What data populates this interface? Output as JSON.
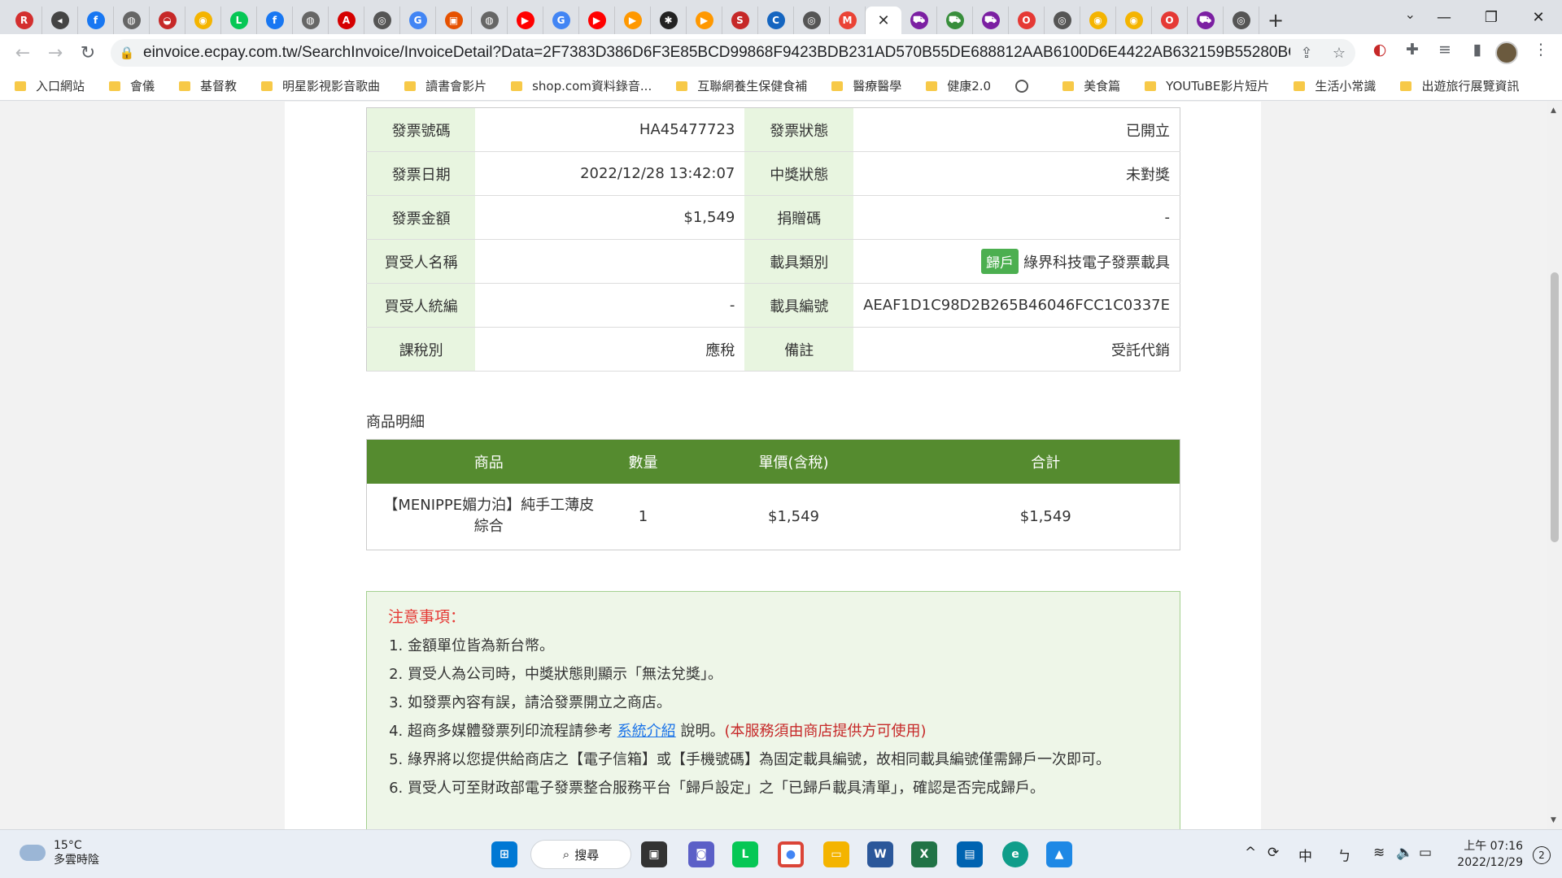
{
  "browser": {
    "tabs": [
      {
        "icon": "ruten-icon",
        "color": "#d32f2f",
        "glyph": "R"
      },
      {
        "icon": "mute-icon",
        "color": "#444",
        "glyph": "◂"
      },
      {
        "icon": "facebook-icon",
        "color": "#1877f2",
        "glyph": "f"
      },
      {
        "icon": "globe-icon",
        "color": "#666",
        "glyph": "◍"
      },
      {
        "icon": "shop-icon",
        "color": "#c62828",
        "glyph": "◒"
      },
      {
        "icon": "duck-icon",
        "color": "#f4b400",
        "glyph": "◉"
      },
      {
        "icon": "line-icon",
        "color": "#06c755",
        "glyph": "L"
      },
      {
        "icon": "facebook-icon",
        "color": "#1877f2",
        "glyph": "f"
      },
      {
        "icon": "globe-icon",
        "color": "#666",
        "glyph": "◍"
      },
      {
        "icon": "ad-icon",
        "color": "#d50000",
        "glyph": "A"
      },
      {
        "icon": "chrome-icon",
        "color": "#555",
        "glyph": "◎"
      },
      {
        "icon": "google-icon",
        "color": "#4285f4",
        "glyph": "G"
      },
      {
        "icon": "slides-icon",
        "color": "#e65100",
        "glyph": "▣"
      },
      {
        "icon": "globe-icon",
        "color": "#666",
        "glyph": "◍"
      },
      {
        "icon": "youtube-icon",
        "color": "#ff0000",
        "glyph": "▶"
      },
      {
        "icon": "google-icon",
        "color": "#4285f4",
        "glyph": "G"
      },
      {
        "icon": "youtube-icon",
        "color": "#ff0000",
        "glyph": "▶"
      },
      {
        "icon": "play-icon",
        "color": "#ff9800",
        "glyph": "▶"
      },
      {
        "icon": "maple-icon",
        "color": "#222",
        "glyph": "✱"
      },
      {
        "icon": "play-icon",
        "color": "#ff9800",
        "glyph": "▶"
      },
      {
        "icon": "skm-icon",
        "color": "#c62828",
        "glyph": "S"
      },
      {
        "icon": "cts-icon",
        "color": "#1565c0",
        "glyph": "C"
      },
      {
        "icon": "chrome-icon",
        "color": "#555",
        "glyph": "◎"
      },
      {
        "icon": "gmail-icon",
        "color": "#ea4335",
        "glyph": "M"
      },
      {
        "icon": "close-icon",
        "color": "#333",
        "glyph": "✕",
        "active": true
      },
      {
        "icon": "cart-icon",
        "color": "#7b1fa2",
        "glyph": "⛟"
      },
      {
        "icon": "cart-icon",
        "color": "#388e3c",
        "glyph": "⛟"
      },
      {
        "icon": "cart-icon",
        "color": "#7b1fa2",
        "glyph": "⛟"
      },
      {
        "icon": "opera-icon",
        "color": "#e53935",
        "glyph": "O"
      },
      {
        "icon": "chrome-icon",
        "color": "#555",
        "glyph": "◎"
      },
      {
        "icon": "duck-icon",
        "color": "#f4b400",
        "glyph": "◉"
      },
      {
        "icon": "duck-icon",
        "color": "#f4b400",
        "glyph": "◉"
      },
      {
        "icon": "opera-icon",
        "color": "#e53935",
        "glyph": "O"
      },
      {
        "icon": "cart-icon",
        "color": "#7b1fa2",
        "glyph": "⛟"
      },
      {
        "icon": "chrome-icon",
        "color": "#555",
        "glyph": "◎"
      }
    ],
    "new_tab": "+",
    "url": "einvoice.ecpay.com.tw/SearchInvoice/InvoiceDetail?Data=2F7383D386D6F3E85BCD99868F9423BDB231AD570B55DE688812AAB6100D6E4422AB632159B55280BCC3A0...",
    "bookmarks": [
      {
        "label": "入口網站",
        "type": "folder"
      },
      {
        "label": "會儀",
        "type": "folder"
      },
      {
        "label": "基督教",
        "type": "folder"
      },
      {
        "label": "明星影視影音歌曲",
        "type": "folder"
      },
      {
        "label": "讀書會影片",
        "type": "folder"
      },
      {
        "label": "shop.com資料錄音...",
        "type": "folder"
      },
      {
        "label": "互聯網養生保健食補",
        "type": "folder"
      },
      {
        "label": "醫療醫學",
        "type": "folder"
      },
      {
        "label": "健康2.0",
        "type": "folder"
      },
      {
        "label": "",
        "type": "globe"
      },
      {
        "label": "美食篇",
        "type": "folder"
      },
      {
        "label": "YOUTuBE影片短片",
        "type": "folder"
      },
      {
        "label": "生活小常識",
        "type": "folder"
      },
      {
        "label": "出遊旅行展覽資訊",
        "type": "folder"
      }
    ]
  },
  "invoice": {
    "rows": [
      {
        "l1": "發票號碼",
        "v1": "HA45477723",
        "l2": "發票狀態",
        "v2": "已開立"
      },
      {
        "l1": "發票日期",
        "v1": "2022/12/28 13:42:07",
        "l2": "中獎狀態",
        "v2": "未對獎"
      },
      {
        "l1": "發票金額",
        "v1": "$1,549",
        "l2": "捐贈碼",
        "v2": "-"
      },
      {
        "l1": "買受人名稱",
        "v1": "",
        "l2": "載具類別",
        "v2": "綠界科技電子發票載具",
        "badge": "歸戶"
      },
      {
        "l1": "買受人統編",
        "v1": "-",
        "l2": "載具編號",
        "v2": "AEAF1D1C98D2B265B46046FCC1C0337E"
      },
      {
        "l1": "課稅別",
        "v1": "應稅",
        "l2": "備註",
        "v2": "受託代銷"
      }
    ]
  },
  "items": {
    "title": "商品明細",
    "headers": [
      "商品",
      "數量",
      "單價(含稅)",
      "合計"
    ],
    "rows": [
      {
        "name": "【MENIPPE媚力泊】純手工薄皮綜合",
        "qty": "1",
        "price": "$1,549",
        "total": "$1,549"
      }
    ]
  },
  "notice": {
    "title": "注意事項：",
    "items": [
      "金額單位皆為新台幣。",
      "買受人為公司時，中獎狀態則顯示「無法兌獎」。",
      "如發票內容有誤，請洽發票開立之商店。",
      "超商多媒體發票列印流程請參考",
      "綠界將以您提供給商店之【電子信箱】或【手機號碼】為固定載具編號，故相同載具編號僅需歸戶一次即可。",
      "買受人可至財政部電子發票整合服務平台「歸戶設定」之「已歸戶載具清單」，確認是否完成歸戶。"
    ],
    "link": "系統介紹",
    "link_after": "說明。",
    "red_note": "(本服務須由商店提供方可使用)"
  },
  "taskbar": {
    "weather_temp": "15°C",
    "weather_desc": "多雲時陰",
    "search_label": "搜尋",
    "ime_label": "中",
    "ime2_label": "ㄅ",
    "time": "上午 07:16",
    "date": "2022/12/29",
    "notifications": "2"
  }
}
